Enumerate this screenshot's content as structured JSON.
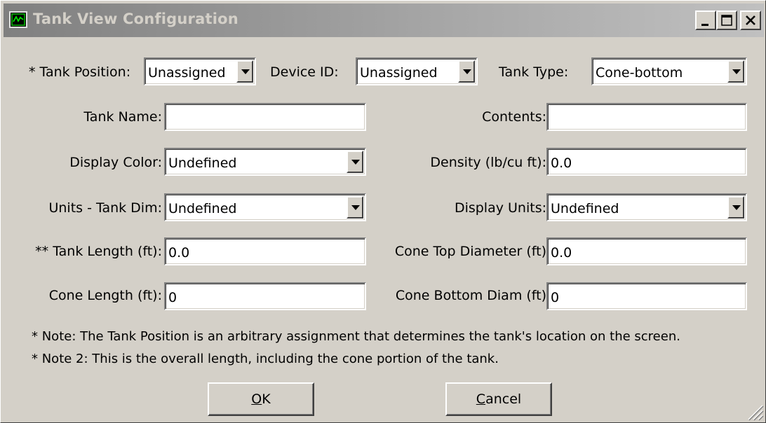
{
  "window": {
    "title": "Tank View Configuration"
  },
  "labels": {
    "tank_position": "* Tank Position:",
    "device_id": "Device ID:",
    "tank_type": "Tank Type:",
    "tank_name": "Tank Name:",
    "contents": "Contents:",
    "display_color": "Display Color:",
    "density": "Density (lb/cu ft):",
    "units_tank_dim": "Units - Tank Dim:",
    "display_units": "Display Units:",
    "tank_length": "** Tank Length (ft):",
    "cone_top_diameter": "Cone Top Diameter (ft)",
    "cone_length": "Cone Length (ft):",
    "cone_bottom_diam": "Cone Bottom Diam (ft)"
  },
  "values": {
    "tank_position": "Unassigned",
    "device_id": "Unassigned",
    "tank_type": "Cone-bottom",
    "tank_name": "",
    "contents": "",
    "display_color": "Undefined",
    "density": "0.0",
    "units_tank_dim": "Undefined",
    "display_units": "Undefined",
    "tank_length": "0.0",
    "cone_top_diameter": "0.0",
    "cone_length": "0",
    "cone_bottom_diam": "0"
  },
  "notes": {
    "note1": "* Note: The Tank Position is an arbitrary assignment that determines the tank's location on the screen.",
    "note2": "* Note 2: This is the overall length, including the cone portion of the tank."
  },
  "buttons": {
    "ok_mnemonic": "O",
    "ok_rest": "K",
    "cancel_mnemonic": "C",
    "cancel_rest": "ancel"
  }
}
